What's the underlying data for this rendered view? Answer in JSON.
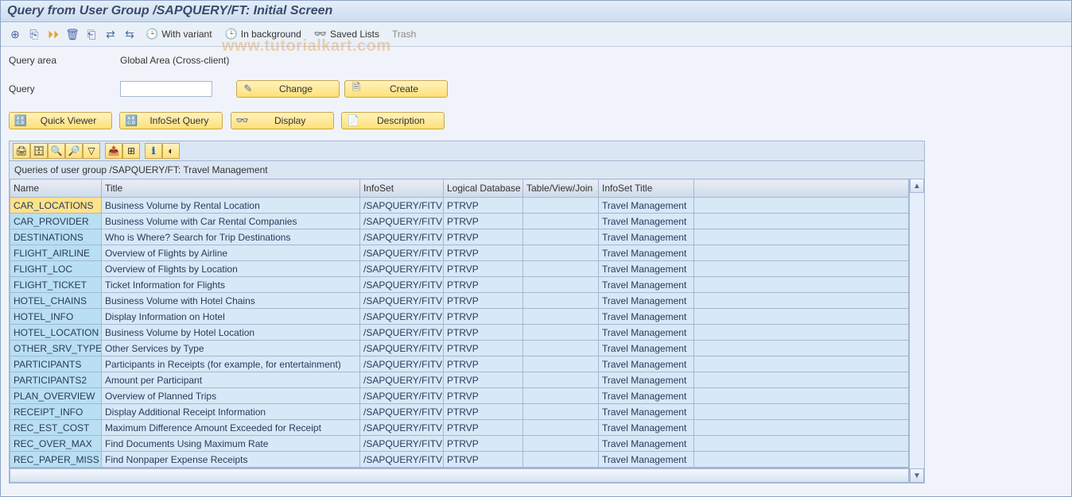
{
  "window": {
    "title": "Query from User Group /SAPQUERY/FT: Initial Screen"
  },
  "menubar": {
    "with_variant": "With variant",
    "in_background": "In background",
    "saved_lists": "Saved Lists",
    "trash": "Trash"
  },
  "fields": {
    "query_area_label": "Query area",
    "query_area_value": "Global Area (Cross-client)",
    "query_label": "Query",
    "query_value": ""
  },
  "buttons": {
    "change": "Change",
    "create": "Create",
    "quick_viewer": "Quick Viewer",
    "infoset_query": "InfoSet Query",
    "display": "Display",
    "description": "Description"
  },
  "table": {
    "header": "Queries of user group /SAPQUERY/FT: Travel Management",
    "columns": [
      "Name",
      "Title",
      "InfoSet",
      "Logical Database",
      "Table/View/Join",
      "InfoSet Title"
    ],
    "rows": [
      {
        "name": "CAR_LOCATIONS",
        "title": "Business Volume by Rental Location",
        "infoset": "/SAPQUERY/FITV",
        "ldb": "PTRVP",
        "tvj": "",
        "ititle": "Travel Management"
      },
      {
        "name": "CAR_PROVIDER",
        "title": "Business Volume with Car Rental Companies",
        "infoset": "/SAPQUERY/FITV",
        "ldb": "PTRVP",
        "tvj": "",
        "ititle": "Travel Management"
      },
      {
        "name": "DESTINATIONS",
        "title": "Who is Where? Search for Trip Destinations",
        "infoset": "/SAPQUERY/FITV",
        "ldb": "PTRVP",
        "tvj": "",
        "ititle": "Travel Management"
      },
      {
        "name": "FLIGHT_AIRLINE",
        "title": "Overview of Flights by Airline",
        "infoset": "/SAPQUERY/FITV",
        "ldb": "PTRVP",
        "tvj": "",
        "ititle": "Travel Management"
      },
      {
        "name": "FLIGHT_LOC",
        "title": "Overview of Flights by Location",
        "infoset": "/SAPQUERY/FITV",
        "ldb": "PTRVP",
        "tvj": "",
        "ititle": "Travel Management"
      },
      {
        "name": "FLIGHT_TICKET",
        "title": "Ticket Information for Flights",
        "infoset": "/SAPQUERY/FITV",
        "ldb": "PTRVP",
        "tvj": "",
        "ititle": "Travel Management"
      },
      {
        "name": "HOTEL_CHAINS",
        "title": "Business Volume with Hotel Chains",
        "infoset": "/SAPQUERY/FITV",
        "ldb": "PTRVP",
        "tvj": "",
        "ititle": "Travel Management"
      },
      {
        "name": "HOTEL_INFO",
        "title": "Display Information on Hotel",
        "infoset": "/SAPQUERY/FITV",
        "ldb": "PTRVP",
        "tvj": "",
        "ititle": "Travel Management"
      },
      {
        "name": "HOTEL_LOCATION",
        "title": "Business Volume by Hotel Location",
        "infoset": "/SAPQUERY/FITV",
        "ldb": "PTRVP",
        "tvj": "",
        "ititle": "Travel Management"
      },
      {
        "name": "OTHER_SRV_TYPE",
        "title": "Other Services by Type",
        "infoset": "/SAPQUERY/FITV",
        "ldb": "PTRVP",
        "tvj": "",
        "ititle": "Travel Management"
      },
      {
        "name": "PARTICIPANTS",
        "title": "Participants in Receipts (for example, for entertainment)",
        "infoset": "/SAPQUERY/FITV",
        "ldb": "PTRVP",
        "tvj": "",
        "ititle": "Travel Management"
      },
      {
        "name": "PARTICIPANTS2",
        "title": "Amount per Participant",
        "infoset": "/SAPQUERY/FITV",
        "ldb": "PTRVP",
        "tvj": "",
        "ititle": "Travel Management"
      },
      {
        "name": "PLAN_OVERVIEW",
        "title": "Overview of Planned Trips",
        "infoset": "/SAPQUERY/FITV",
        "ldb": "PTRVP",
        "tvj": "",
        "ititle": "Travel Management"
      },
      {
        "name": "RECEIPT_INFO",
        "title": "Display Additional Receipt Information",
        "infoset": "/SAPQUERY/FITV",
        "ldb": "PTRVP",
        "tvj": "",
        "ititle": "Travel Management"
      },
      {
        "name": "REC_EST_COST",
        "title": "Maximum Difference Amount Exceeded for Receipt",
        "infoset": "/SAPQUERY/FITV",
        "ldb": "PTRVP",
        "tvj": "",
        "ititle": "Travel Management"
      },
      {
        "name": "REC_OVER_MAX",
        "title": "Find Documents Using Maximum Rate",
        "infoset": "/SAPQUERY/FITV",
        "ldb": "PTRVP",
        "tvj": "",
        "ititle": "Travel Management"
      },
      {
        "name": "REC_PAPER_MISS",
        "title": "Find Nonpaper Expense Receipts",
        "infoset": "/SAPQUERY/FITV",
        "ldb": "PTRVP",
        "tvj": "",
        "ititle": "Travel Management"
      }
    ]
  },
  "watermark": "www.tutorialkart.com"
}
